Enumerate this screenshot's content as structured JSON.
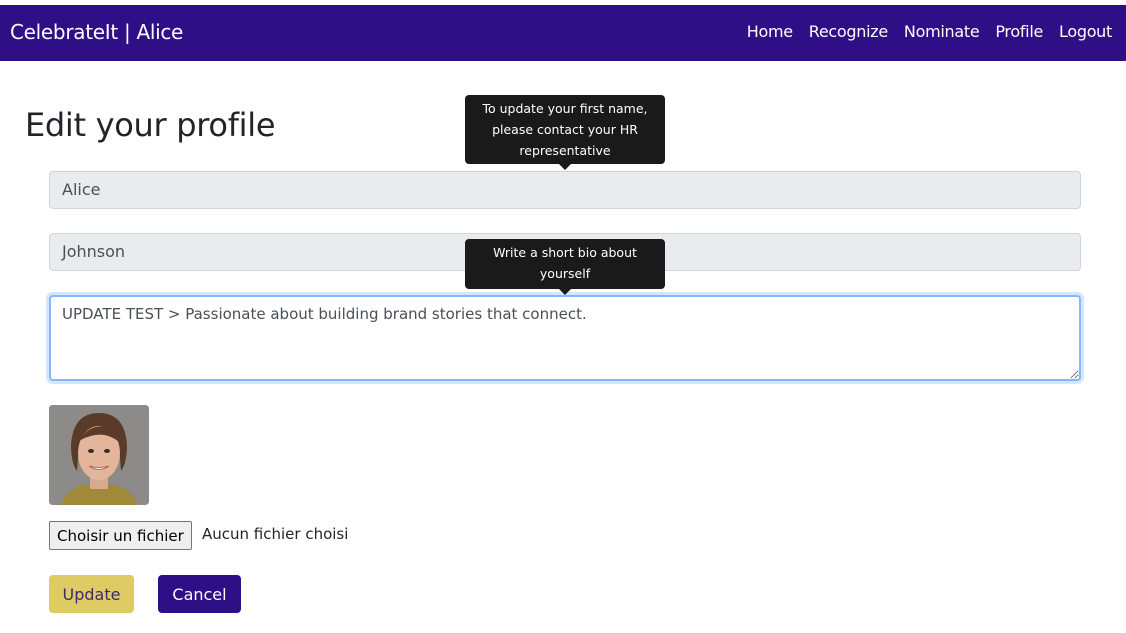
{
  "navbar": {
    "brand": "CelebrateIt | Alice",
    "links": [
      "Home",
      "Recognize",
      "Nominate",
      "Profile",
      "Logout"
    ],
    "background": "#2e0f86"
  },
  "page": {
    "title": "Edit your profile"
  },
  "form": {
    "first_name": "Alice",
    "last_name": "Johnson",
    "bio": "UPDATE TEST > Passionate about building brand stories that connect.",
    "first_name_tooltip": "To update your first name, please contact your HR representative",
    "bio_tooltip": "Write a short bio about yourself",
    "file_button": "Choisir un fichier",
    "file_status": "Aucun fichier choisi",
    "update_label": "Update",
    "cancel_label": "Cancel",
    "update_color": "#dfcb63",
    "cancel_color": "#2e0f86"
  },
  "icons": {
    "avatar": "user-photo"
  }
}
